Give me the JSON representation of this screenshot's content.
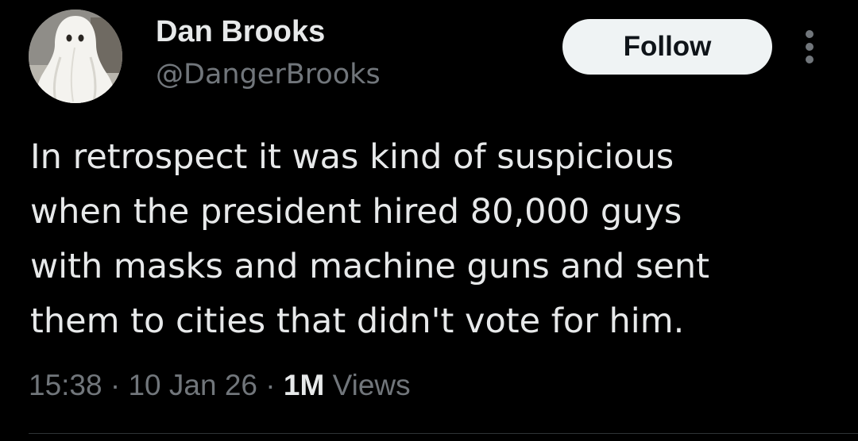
{
  "tweet": {
    "author": {
      "display_name": "Dan Brooks",
      "handle": "@DangerBrooks",
      "avatar_icon": "ghost-costume-avatar-icon"
    },
    "follow_label": "Follow",
    "more_icon": "more-vertical-icon",
    "text_lines": [
      "In retrospect it was kind of suspicious",
      "when the president hired 80,000 guys",
      "with masks and machine guns and sent",
      "them to cities that didn't vote for him."
    ],
    "meta": {
      "time": "15:38",
      "separator": "·",
      "date": "10 Jan 26",
      "views_count": "1M",
      "views_label": "Views"
    }
  },
  "colors": {
    "background": "#000000",
    "primary_text": "#e7e9ea",
    "secondary_text": "#71767b",
    "follow_button_bg": "#eff3f4",
    "follow_button_text": "#0f1419",
    "divider": "#2f3336"
  }
}
